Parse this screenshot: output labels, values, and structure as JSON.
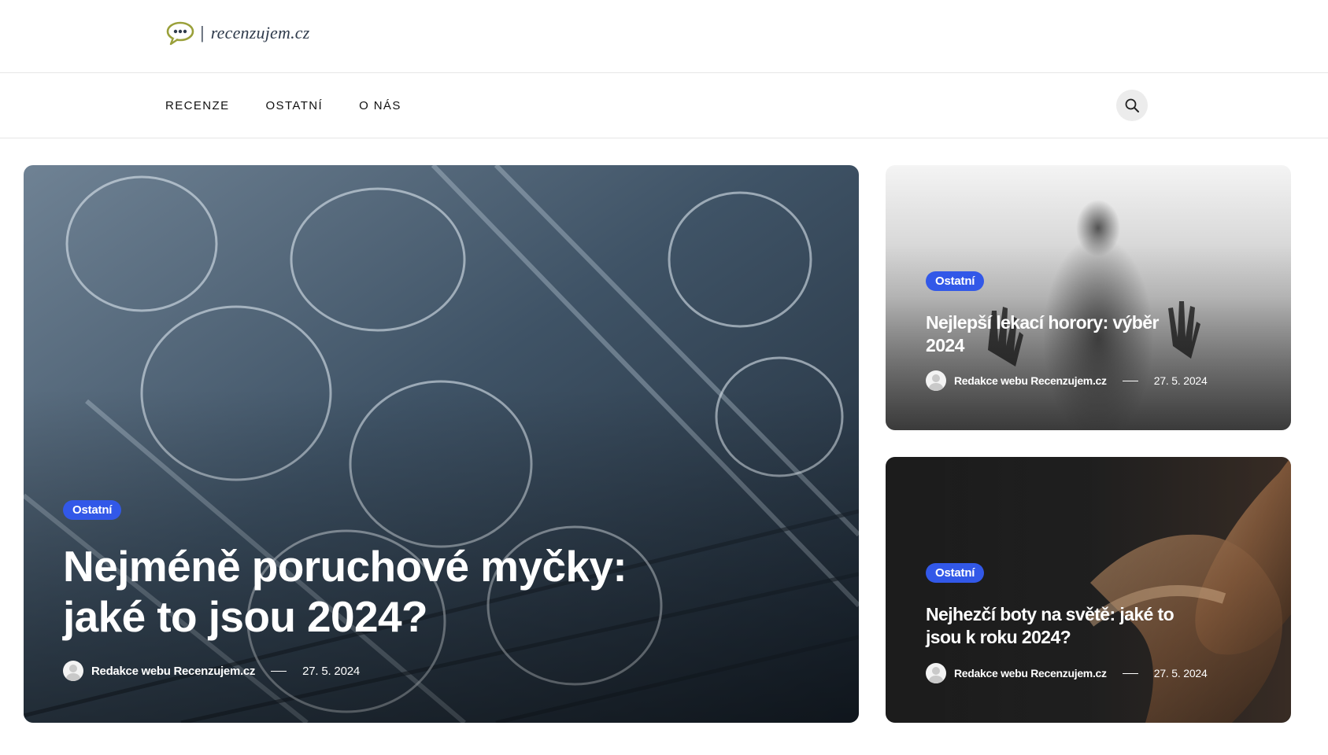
{
  "header": {
    "logo_separator": "|",
    "logo_text": "recenzujem.cz"
  },
  "nav": {
    "items": [
      {
        "label": "RECENZE"
      },
      {
        "label": "OSTATNÍ"
      },
      {
        "label": "O NÁS"
      }
    ],
    "search_icon": "search-icon"
  },
  "articles": [
    {
      "category": "Ostatní",
      "title_line1": "Nejméně poruchové myčky:",
      "title_line2": "jaké to jsou 2024?",
      "author": "Redakce webu Recenzujem.cz",
      "date": "27. 5. 2024"
    },
    {
      "category": "Ostatní",
      "title_line1": "Nejlepší lekací horory: výběr",
      "title_line2": "2024",
      "author": "Redakce webu Recenzujem.cz",
      "date": "27. 5. 2024"
    },
    {
      "category": "Ostatní",
      "title_line1": "Nejhezčí boty na světě: jaké to",
      "title_line2": "jsou k roku 2024?",
      "author": "Redakce webu Recenzujem.cz",
      "date": "27. 5. 2024"
    }
  ],
  "colors": {
    "badge": "#3258e8",
    "logo_bubble": "#9aa03a",
    "logo_text": "#2f3b4c"
  }
}
